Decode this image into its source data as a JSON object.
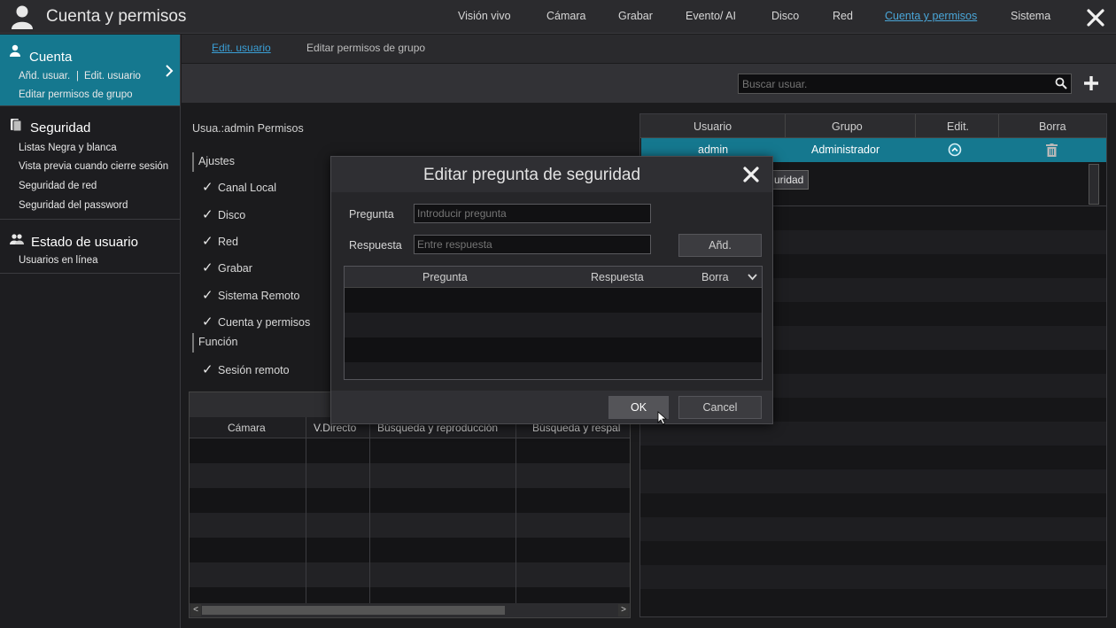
{
  "app": {
    "title": "Cuenta y permisos"
  },
  "topnav": [
    {
      "label": "Visión vivo",
      "active": false
    },
    {
      "label": "Cámara",
      "active": false
    },
    {
      "label": "Grabar",
      "active": false
    },
    {
      "label": "Evento/ AI",
      "active": false
    },
    {
      "label": "Disco",
      "active": false
    },
    {
      "label": "Red",
      "active": false
    },
    {
      "label": "Cuenta y permisos",
      "active": true
    },
    {
      "label": "Sistema",
      "active": false
    }
  ],
  "sidebar": {
    "cuenta": {
      "title": "Cuenta",
      "link1": "Añd. usuar.",
      "divider": "|",
      "link2": "Edit. usuario",
      "link3": "Editar permisos de grupo"
    },
    "seguridad": {
      "title": "Seguridad",
      "items": [
        "Listas Negra y blanca",
        "Vista previa cuando cierre sesión",
        "Seguridad de red",
        "Seguridad del password"
      ]
    },
    "estado": {
      "title": "Estado de usuario",
      "items": [
        "Usuarios en línea"
      ]
    }
  },
  "subtabs": [
    {
      "label": "Edit. usuario",
      "active": true
    },
    {
      "label": "Editar permisos de grupo",
      "active": false
    }
  ],
  "search": {
    "placeholder": "Buscar usuar."
  },
  "permissions": {
    "title": "Usua.:admin Permisos",
    "section1": "Ajustes",
    "items1": [
      "Canal Local",
      "Disco",
      "Red",
      "Grabar",
      "Sistema Remoto",
      "Cuenta y permisos"
    ],
    "section2": "Función",
    "items2": [
      "Sesión remoto"
    ]
  },
  "camera_table": {
    "columns": [
      "Cámara",
      "V.Directo",
      "Búsqueda y reproducción",
      "Búsqueda y respal"
    ]
  },
  "user_table": {
    "columns": [
      "Usuario",
      "Grupo",
      "Edit.",
      "Borra"
    ],
    "rows": [
      {
        "user": "admin",
        "group": "Administrador"
      }
    ],
    "detail_button": "uridad"
  },
  "modal": {
    "title": "Editar pregunta de seguridad",
    "question_label": "Pregunta",
    "question_placeholder": "Introducir pregunta",
    "answer_label": "Respuesta",
    "answer_placeholder": "Entre respuesta",
    "add_button": "Añd.",
    "table_columns": [
      "Pregunta",
      "Respuesta",
      "Borra"
    ],
    "ok_button": "OK",
    "cancel_button": "Cancel"
  },
  "colors": {
    "accent": "#15788f",
    "link": "#4aa6d8"
  }
}
